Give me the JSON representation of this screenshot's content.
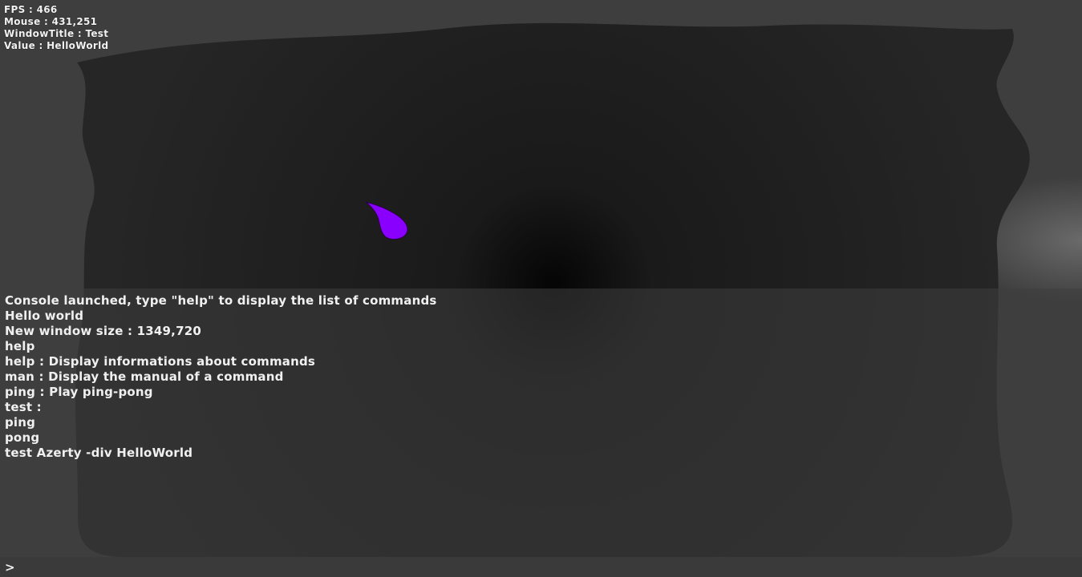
{
  "debug": {
    "fps": "FPS : 466",
    "mouse": "Mouse : 431,251",
    "window_title": "WindowTitle : Test",
    "value": "Value : HelloWorld"
  },
  "console": {
    "lines": [
      "Console launched, type \"help\" to display the list of commands",
      "Hello world",
      "New window size : 1349,720",
      "help",
      "help : Display informations about commands",
      "man : Display the manual of a command",
      "ping : Play ping-pong",
      "test :",
      "ping",
      "pong",
      "test Azerty -div HelloWorld"
    ],
    "prompt": ">",
    "input_value": ""
  },
  "colors": {
    "background": "#3e3e3e",
    "blob_fill": "#1c1c1c",
    "shape_fill": "#8a00ff",
    "console_text": "#f0f0f0"
  }
}
